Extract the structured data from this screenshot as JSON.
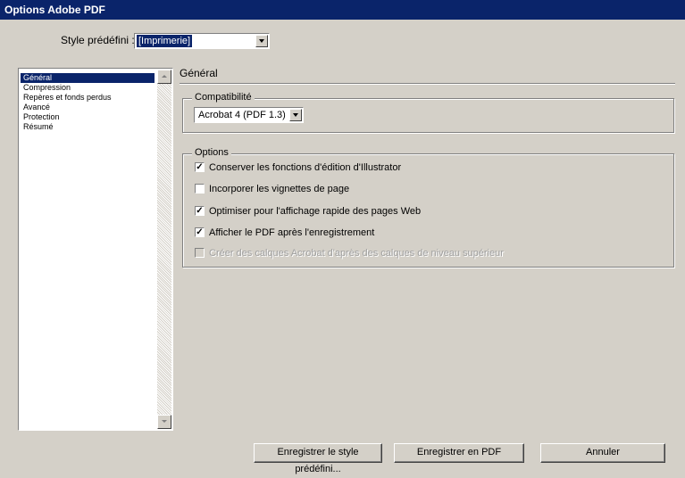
{
  "window": {
    "title": "Options Adobe PDF"
  },
  "preset": {
    "label": "Style prédéfini :",
    "value": "[Imprimerie]"
  },
  "sidebar": {
    "items": [
      {
        "label": "Général",
        "selected": true
      },
      {
        "label": "Compression"
      },
      {
        "label": "Repères et fonds perdus"
      },
      {
        "label": "Avancé"
      },
      {
        "label": "Protection"
      },
      {
        "label": "Résumé"
      }
    ]
  },
  "panel": {
    "title": "Général",
    "compatibility": {
      "legend": "Compatibilité",
      "value": "Acrobat 4 (PDF 1.3)"
    },
    "options": {
      "legend": "Options",
      "items": [
        {
          "label": "Conserver les fonctions d'édition d'Illustrator",
          "checked": true,
          "enabled": true
        },
        {
          "label": "Incorporer les vignettes de page",
          "checked": false,
          "enabled": true
        },
        {
          "label": "Optimiser pour l'affichage rapide des pages Web",
          "checked": true,
          "enabled": true
        },
        {
          "label": "Afficher le PDF après l'enregistrement",
          "checked": true,
          "enabled": true
        },
        {
          "label": "Créer des calques Acrobat d'après des calques de niveau supérieur",
          "checked": false,
          "enabled": false
        }
      ]
    }
  },
  "buttons": {
    "save_preset": "Enregistrer le style prédéfini...",
    "save_pdf": "Enregistrer en PDF",
    "cancel": "Annuler"
  },
  "colors": {
    "titlebar": "#0a246a",
    "face": "#d4d0c8",
    "selection": "#0a246a"
  }
}
